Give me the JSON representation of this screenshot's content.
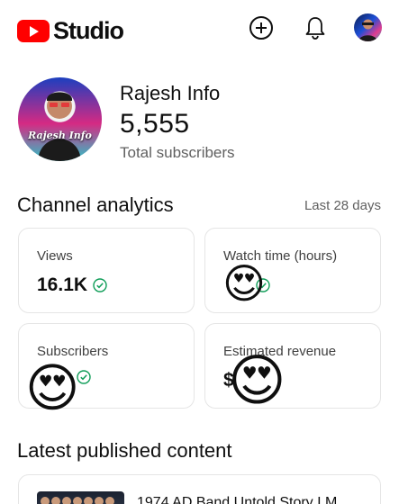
{
  "header": {
    "logo_text": "Studio",
    "create_icon": "add-circle-icon",
    "notifications_icon": "bell-icon",
    "account_icon": "avatar"
  },
  "channel": {
    "name": "Rajesh Info",
    "avatar_text": "Rajesh Info",
    "subscriber_count": "5,555",
    "subscriber_label": "Total subscribers"
  },
  "analytics": {
    "title": "Channel analytics",
    "period": "Last 28 days",
    "cards": [
      {
        "label": "Views",
        "value": "16.1K"
      },
      {
        "label": "Watch time (hours)",
        "value": ""
      },
      {
        "label": "Subscribers",
        "value": ""
      },
      {
        "label": "Estimated revenue",
        "value": "$"
      }
    ]
  },
  "latest": {
    "title": "Latest published content",
    "items": [
      {
        "title": "1974 AD Band Untold Story I M"
      }
    ]
  },
  "overlays": {
    "emoji": "😍"
  },
  "colors": {
    "brand_red": "#ff0000",
    "check_green": "#0f9d58",
    "muted_text": "#606060"
  }
}
